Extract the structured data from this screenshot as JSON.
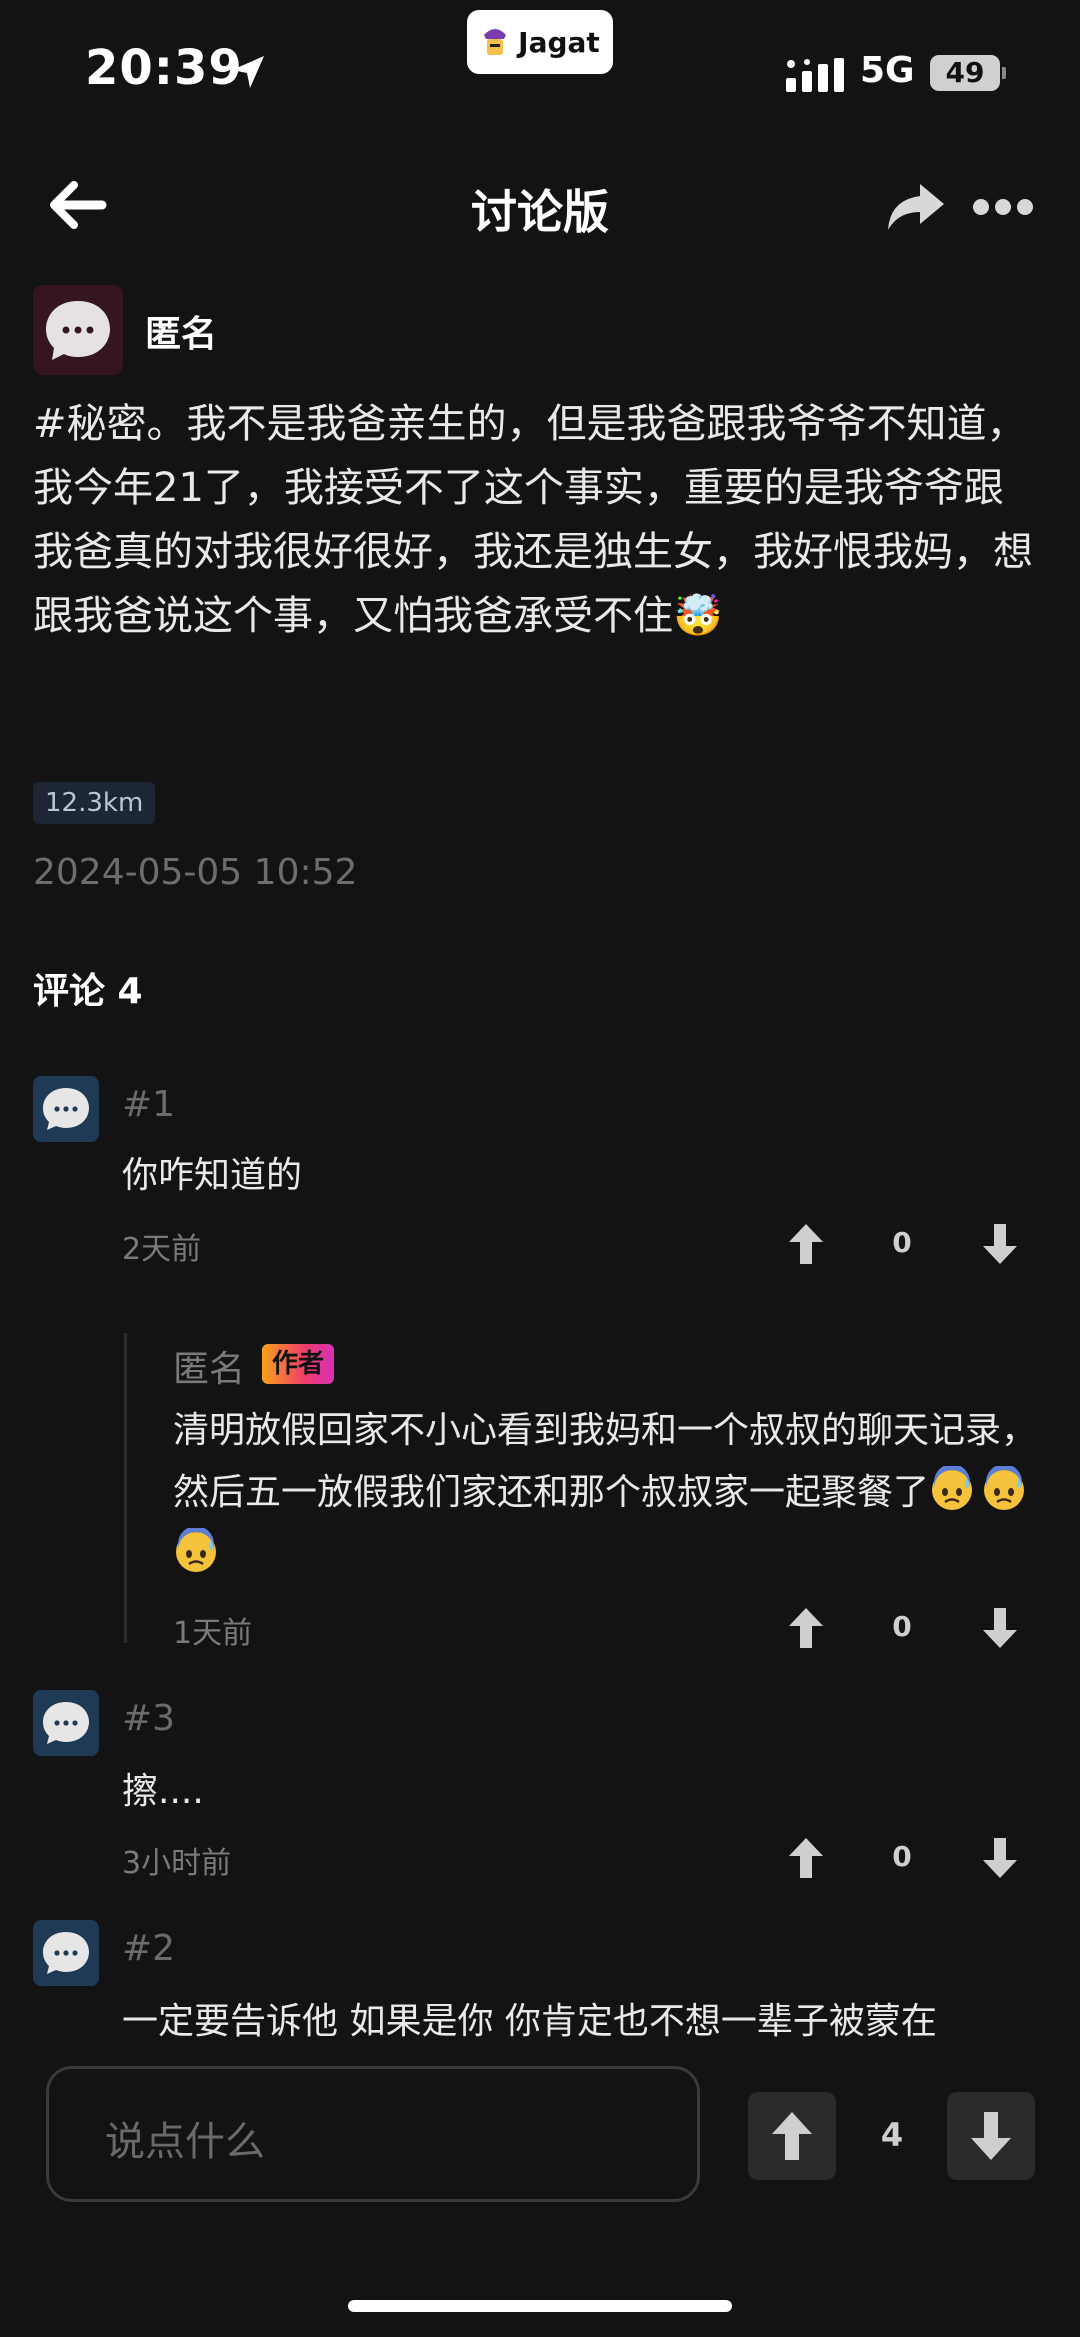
{
  "status_bar": {
    "time": "20:39",
    "app_name": "Jagat",
    "network": "5G",
    "battery": "49"
  },
  "nav": {
    "title": "讨论版"
  },
  "post": {
    "author": "匿名",
    "body": "#秘密。我不是我爸亲生的，但是我爸跟我爷爷不知道，我今年21了，我接受不了这个事实，重要的是我爷爷跟我爸真的对我很好很好，我还是独生女，我好恨我妈，想跟我爸说这个事，又怕我爸承受不住🤯",
    "distance": "12.3km",
    "date": "2024-05-05 10:52"
  },
  "comments_heading": "评论 4",
  "comments": [
    {
      "tag": "#1",
      "text": "你咋知道的",
      "time": "2天前",
      "votes": "0"
    },
    {
      "tag": "#3",
      "text": "擦....",
      "time": "3小时前",
      "votes": "0"
    },
    {
      "tag": "#2",
      "text": "一定要告诉他 如果是你 你肯定也不想一辈子被蒙在"
    }
  ],
  "reply": {
    "author": "匿名",
    "badge": "作者",
    "body": "清明放假回家不小心看到我妈和一个叔叔的聊天记录，然后五一放假我们家还和那个叔叔家一起聚餐了",
    "emoji_count": 3,
    "time": "1天前",
    "votes": "0"
  },
  "input_bar": {
    "placeholder": "说点什么",
    "votes": "4"
  },
  "colors": {
    "background": "#131313",
    "post_avatar": "#351521",
    "comment_avatar": "#1f3a55",
    "muted_text": "#6d6d6d"
  },
  "icons": [
    "location-arrow-icon",
    "signal-icon",
    "back-arrow-icon",
    "share-icon",
    "more-icon",
    "chat-bubble-icon",
    "arrow-up-icon",
    "arrow-down-icon",
    "cold-sweat-emoji-icon"
  ]
}
